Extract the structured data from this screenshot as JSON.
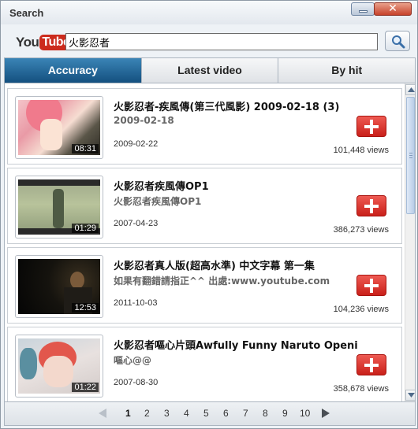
{
  "window": {
    "title": "Search"
  },
  "search": {
    "logo_you": "You",
    "logo_tube": "Tube",
    "query": "火影忍者"
  },
  "tabs": [
    {
      "label": "Accuracy",
      "active": true
    },
    {
      "label": "Latest video",
      "active": false
    },
    {
      "label": "By hit",
      "active": false
    }
  ],
  "videos": [
    {
      "title": "火影忍者-疾風傳(第三代風影) 2009-02-18 (3)",
      "subtitle": "2009-02-18",
      "date": "2009-02-22",
      "views": "101,448 views",
      "duration": "08:31"
    },
    {
      "title": "火影忍者疾風傳OP1",
      "subtitle": "火影忍者疾風傳OP1",
      "date": "2007-04-23",
      "views": "386,273 views",
      "duration": "01:29"
    },
    {
      "title": "火影忍者真人版(超高水準) 中文字幕 第一集",
      "subtitle": "如果有翻錯請指正^^ 出處:www.youtube.com",
      "date": "2011-10-03",
      "views": "104,236 views",
      "duration": "12:53"
    },
    {
      "title": "火影忍者嘔心片頭Awfully Funny Naruto Openi…",
      "subtitle": "嘔心@@",
      "date": "2007-08-30",
      "views": "358,678 views",
      "duration": "01:22"
    }
  ],
  "pager": {
    "pages": [
      "1",
      "2",
      "3",
      "4",
      "5",
      "6",
      "7",
      "8",
      "9",
      "10"
    ],
    "current": "1"
  },
  "colors": {
    "active_tab": "#1f6396",
    "add_button": "#d7322a",
    "logo_red": "#cc2b1c"
  },
  "icons": [
    "minimize-icon",
    "close-icon",
    "magnifier-icon",
    "plus-icon",
    "arrow-up-icon",
    "arrow-down-icon",
    "prev-page-icon",
    "next-page-icon"
  ]
}
